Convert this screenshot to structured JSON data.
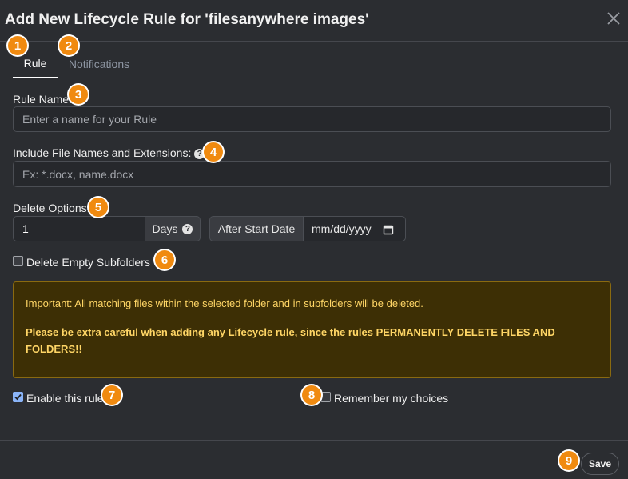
{
  "dialog": {
    "title": "Add New Lifecycle Rule for 'filesanywhere images'",
    "close_icon": "close-icon"
  },
  "tabs": [
    {
      "label": "Rule",
      "active": true
    },
    {
      "label": "Notifications",
      "active": false
    }
  ],
  "form": {
    "rule_name_label": "Rule Name:",
    "rule_name_placeholder": "Enter a name for your Rule",
    "include_label": "Include File Names and Extensions:",
    "include_placeholder": "Ex: *.docx, name.docx",
    "delete_options_label": "Delete Options:",
    "days_value": "1",
    "days_addon": "Days",
    "after_start_label": "After Start Date",
    "date_placeholder": "mm/dd/yyyy",
    "delete_empty_label": "Delete Empty Subfolders",
    "delete_empty_checked": false,
    "enable_rule_label": "Enable this rule",
    "enable_rule_checked": true,
    "remember_label": "Remember my choices",
    "remember_checked": false
  },
  "warning": {
    "text1": "Important: All matching files within the selected folder and in subfolders will be deleted.",
    "text2": "Please be extra careful when adding any Lifecycle rule, since the rules PERMANENTLY DELETE FILES AND FOLDERS!!"
  },
  "footer": {
    "save_label": "Save"
  },
  "badges": [
    "1",
    "2",
    "3",
    "4",
    "5",
    "6",
    "7",
    "8",
    "9"
  ],
  "colors": {
    "background": "#2b2d31",
    "badge": "#f08a10",
    "warning_bg": "#3d2f05",
    "warning_text": "#ffd666",
    "check_accent": "#8ab4f8"
  }
}
